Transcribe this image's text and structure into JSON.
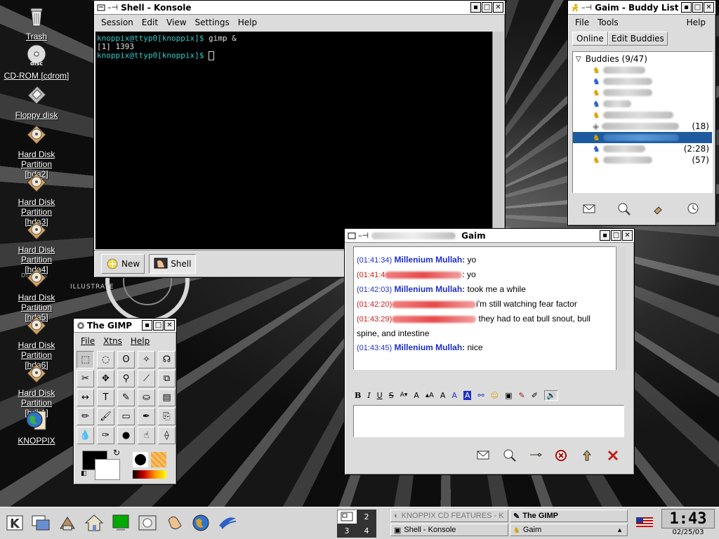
{
  "desktop": {
    "icons": [
      {
        "label": "Trash",
        "icon": "trash-icon"
      },
      {
        "label": "CD-ROM [cdrom]",
        "icon": "cdrom-icon",
        "badge": "disc"
      },
      {
        "label": "Floppy disk",
        "icon": "floppy-icon"
      },
      {
        "label": "Hard Disk Partition [hda2]",
        "icon": "hard-disk-icon"
      },
      {
        "label": "Hard Disk Partition [hda3]",
        "icon": "hard-disk-icon"
      },
      {
        "label": "Hard Disk Partition [hda4]",
        "icon": "hard-disk-icon"
      },
      {
        "label": "Hard Disk Partition [hda5]",
        "icon": "hard-disk-icon"
      },
      {
        "label": "Hard Disk Partition [hda6]",
        "icon": "hard-disk-icon"
      },
      {
        "label": "Hard Disk Partition [hdb1]",
        "icon": "hard-disk-icon"
      },
      {
        "label": "KNOPPIX",
        "icon": "knoppix-globe-icon"
      }
    ],
    "wallpaper_text": [
      "DIGITAL",
      "ILLUSTRATE"
    ]
  },
  "konsole": {
    "title": "Shell - Konsole",
    "menu": [
      "Session",
      "Edit",
      "View",
      "Settings",
      "Help"
    ],
    "lines": [
      {
        "prompt": "knoppix@ttyp0[knoppix]$",
        "cmd": " gimp &"
      },
      {
        "prompt": "",
        "cmd": "[1] 1393"
      },
      {
        "prompt": "knoppix@ttyp0[knoppix]$",
        "cmd": " "
      }
    ],
    "new_label": "New",
    "shell_tab": "Shell"
  },
  "buddy_list": {
    "title": "Gaim - Buddy List",
    "menu": [
      "File",
      "Tools",
      "Help"
    ],
    "tabs": [
      "Online",
      "Edit Buddies"
    ],
    "group": "Buddies (9/47)",
    "buddies": [
      {
        "idle": "",
        "away": false
      },
      {
        "idle": "",
        "away": false
      },
      {
        "idle": "",
        "away": false
      },
      {
        "idle": "",
        "away": false
      },
      {
        "idle": "",
        "away": false
      },
      {
        "idle": "(18)",
        "away": true
      },
      {
        "idle": "",
        "away": false,
        "selected": true
      },
      {
        "idle": "(2:28)",
        "away": false
      },
      {
        "idle": "(57)",
        "away": false
      }
    ],
    "bottom_buttons": [
      "im-icon",
      "info-icon",
      "chat-icon",
      "away-icon"
    ]
  },
  "gaim_chat": {
    "title": "Gaim",
    "messages": [
      {
        "time": "(01:41:34)",
        "nick": "Millenium Mullah:",
        "text": " yo",
        "self": true
      },
      {
        "time": "(01:41:4",
        "nick": "",
        "text": ": yo",
        "self": false
      },
      {
        "time": "(01:42:03)",
        "nick": "Millenium Mullah:",
        "text": " took me a while",
        "self": true
      },
      {
        "time": "(01:42:20)",
        "nick": "",
        "text": "i'm still watching fear factor",
        "self": false
      },
      {
        "time": "(01:43:29)",
        "nick": "",
        "text": " they had to eat bull snout, bull spine, and intestine",
        "self": false
      },
      {
        "time": "(01:43:45)",
        "nick": "Millenium Mullah:",
        "text": " nice",
        "self": true
      }
    ],
    "format_buttons": [
      "B",
      "I",
      "U",
      "S"
    ],
    "input_value": ""
  },
  "gimp": {
    "title": "The GIMP",
    "menu": [
      "File",
      "Xtns",
      "Help"
    ],
    "tools": [
      "rect-select-icon",
      "ellipse-select-icon",
      "lasso-icon",
      "fuzzy-select-icon",
      "bezier-select-icon",
      "scissors-icon",
      "move-icon",
      "magnify-icon",
      "crop-icon",
      "transform-icon",
      "flip-icon",
      "text-icon",
      "color-picker-icon",
      "bucket-fill-icon",
      "blend-icon",
      "pencil-icon",
      "paintbrush-icon",
      "eraser-icon",
      "airbrush-icon",
      "clone-icon",
      "blur-icon",
      "ink-icon",
      "dodge-icon",
      "smudge-icon",
      "measure-icon"
    ],
    "tool_glyphs": [
      "⬚",
      "◌",
      "ʘ",
      "✧",
      "☊",
      "✂",
      "✥",
      "⚲",
      "⟋",
      "⧉",
      "↔",
      "T",
      "✎",
      "⛀",
      "▤",
      "✏",
      "🖌",
      "▭",
      "✒",
      "⎘",
      "💧",
      "✑",
      "●",
      "☝",
      "⟠"
    ],
    "fg_color": "#000000",
    "bg_color": "#ffffff"
  },
  "taskbar": {
    "desktops": [
      "1",
      "2",
      "3",
      "4"
    ],
    "tasks": [
      {
        "label": "KNOPPIX CD FEATURES - K",
        "dim": true
      },
      {
        "label": "The GIMP",
        "bold": true
      },
      {
        "label": "Shell - Konsole",
        "bold": false
      },
      {
        "label": "Gaim",
        "bold": false
      }
    ],
    "clock": "1:43",
    "date": "02/25/03",
    "launchers": [
      "kmenu-icon",
      "window-list-icon",
      "desktop-icon",
      "home-icon",
      "terminal-icon",
      "konqueror-icon",
      "help-icon",
      "browser-icon",
      "office-icon"
    ]
  }
}
